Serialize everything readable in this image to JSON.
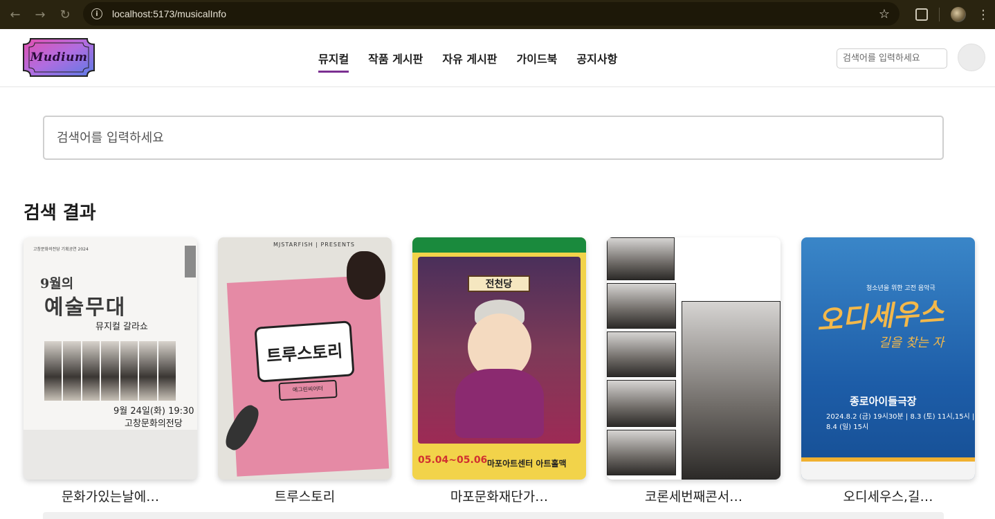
{
  "browser": {
    "url": "localhost:5173/musicalInfo"
  },
  "header": {
    "logo_text": "Mudium",
    "nav": [
      {
        "label": "뮤지컬",
        "active": true
      },
      {
        "label": "작품 게시판",
        "active": false
      },
      {
        "label": "자유 게시판",
        "active": false
      },
      {
        "label": "가이드북",
        "active": false
      },
      {
        "label": "공지사항",
        "active": false
      }
    ],
    "search_placeholder": "검색어를 입력하세요"
  },
  "main": {
    "search_placeholder": "검색어를 입력하세요",
    "results_heading": "검색 결과",
    "results": [
      {
        "title": "문화가있는날에…",
        "poster": {
          "header": "고창문화의전당 기획공연 2024",
          "line1": "9월의",
          "line2": "예술무대",
          "sub": "뮤지컬 갈라쇼",
          "date": "9월 24일(화) 19:30",
          "venue": "고창문화의전당"
        }
      },
      {
        "title": "트루스토리",
        "poster": {
          "top": "MJSTARFISH | PRESENTS",
          "sign": "트루스토리",
          "tag": "에그린씨어터"
        }
      },
      {
        "title": "마포문화재단가…",
        "poster": {
          "sign": "전천당",
          "date": "05.04~05.06",
          "venue": "마포아트센터 아트홀맥"
        }
      },
      {
        "title": "코론세번째콘서…",
        "poster": {}
      },
      {
        "title": "오디세우스,길…",
        "poster": {
          "small": "청소년을 위한 고전 음악극",
          "title": "오디세우스",
          "sub": "길을 찾는 자",
          "venue": "종로아이들극장",
          "dates": "2024.8.2 (금) 19시30분 | 8.3 (토) 11시,15시 | 8.4 (일) 15시"
        }
      }
    ]
  },
  "colors": {
    "chrome_bg": "#2a2410",
    "accent": "#7b2f91"
  }
}
